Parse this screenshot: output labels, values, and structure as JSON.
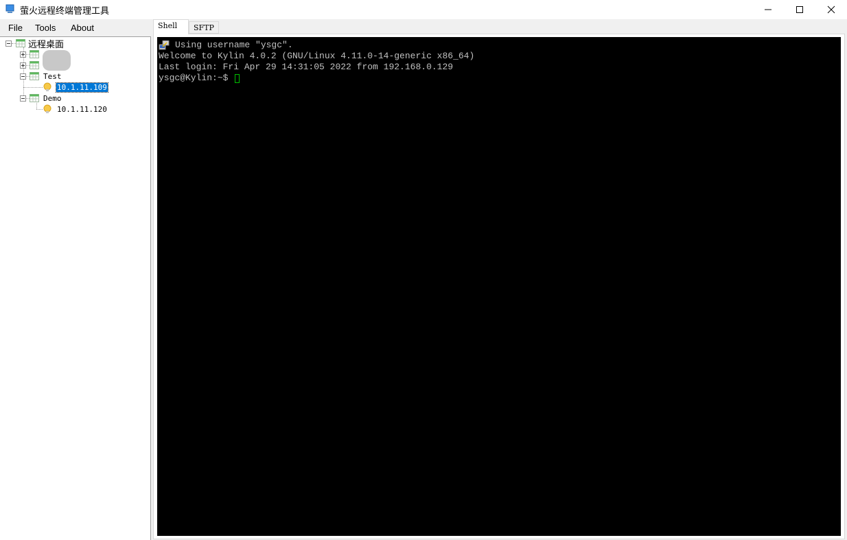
{
  "window": {
    "title": "萤火远程终端管理工具",
    "controls": {
      "minimize": "minimize",
      "maximize": "maximize",
      "close": "close"
    }
  },
  "menu": {
    "items": [
      {
        "label": "File"
      },
      {
        "label": "Tools"
      },
      {
        "label": "About"
      }
    ]
  },
  "tree": {
    "root": {
      "label": "远程桌面",
      "expanded": true
    },
    "groups": [
      {
        "label": "",
        "expanded": false,
        "redacted": true
      },
      {
        "label": "",
        "expanded": false,
        "redacted": true
      },
      {
        "label": "Test",
        "expanded": true,
        "children": [
          {
            "label": "10.1.11.109",
            "selected": true
          }
        ]
      },
      {
        "label": "Demo",
        "expanded": true,
        "children": [
          {
            "label": "10.1.11.120",
            "selected": false
          }
        ]
      }
    ]
  },
  "tabs": [
    {
      "label": "Shell",
      "active": true
    },
    {
      "label": "SFTP",
      "active": false
    }
  ],
  "terminal": {
    "lines": [
      "Using username \"ysgc\".",
      "Welcome to Kylin 4.0.2 (GNU/Linux 4.11.0-14-generic x86_64)",
      "Last login: Fri Apr 29 14:31:05 2022 from 192.168.0.129",
      "ysgc@Kylin:~$ "
    ],
    "colors": {
      "background": "#000000",
      "foreground": "#c0c0c0",
      "cursor": "#00c000"
    }
  },
  "colors": {
    "selection": "#0078d7"
  }
}
